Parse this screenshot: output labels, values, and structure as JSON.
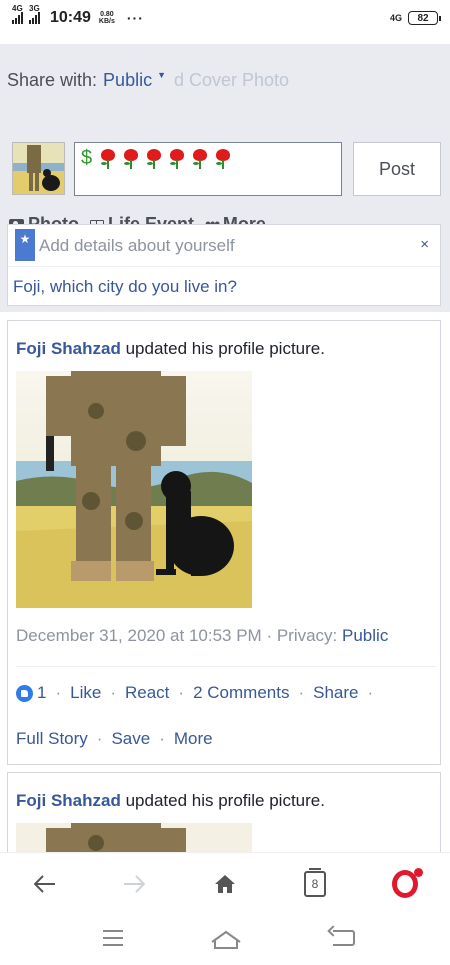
{
  "status_bar": {
    "net1": "4G",
    "net2": "3G",
    "time": "10:49",
    "speed_value": "0.80",
    "speed_unit": "KB/s",
    "more": "···",
    "net_right": "4G",
    "battery": "82"
  },
  "composer": {
    "share_label": "Share with:",
    "audience": "Public",
    "cover_photo": "d Cover Photo",
    "post_text": "$",
    "post_button": "Post",
    "actions": [
      {
        "label": "Photo",
        "icon": "camera-icon"
      },
      {
        "label": "Life Event",
        "icon": "book-icon"
      },
      {
        "label": "More",
        "icon": "dots-icon"
      }
    ]
  },
  "details_prompt": {
    "title": "Add details about yourself",
    "close": "×",
    "question": "Foji, which city do you live in?"
  },
  "stories": [
    {
      "author": "Foji Shahzad",
      "action": "updated his profile picture.",
      "date": "December 31, 2020 at 10:53 PM",
      "privacy_label": "· Privacy:",
      "privacy_value": "Public",
      "likes": "1",
      "like": "Like",
      "react": "React",
      "comments": "2 Comments",
      "share": "Share",
      "full_story": "Full Story",
      "save": "Save",
      "more": "More"
    },
    {
      "author": "Foji Shahzad",
      "action": "updated his profile picture."
    }
  ],
  "toolbar": {
    "tabs_count": "8"
  },
  "colors": {
    "link": "#385898",
    "composer_bg": "#e9ebf0",
    "opera_red": "#e0192d"
  }
}
